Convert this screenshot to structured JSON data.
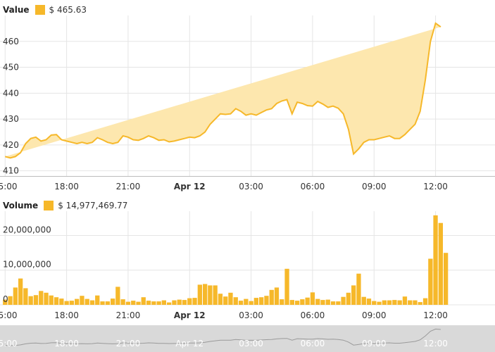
{
  "colors": {
    "series": "#f6b82a",
    "fill": "#fde7ae",
    "grid": "#e5e5e5",
    "axis": "#333333",
    "navigator_bg": "#d9d9d9",
    "navigator_line": "#9a9a9a"
  },
  "x_tick_labels": [
    "15:00",
    "18:00",
    "21:00",
    "Apr 12",
    "03:00",
    "06:00",
    "09:00",
    "12:00"
  ],
  "value_panel": {
    "label": "Value",
    "current": "$ 465.63"
  },
  "volume_panel": {
    "label": "Volume",
    "current": "$ 14,977,469.77"
  },
  "chart_data": [
    {
      "type": "area",
      "title": "Value",
      "x_unit": "hours since first tick",
      "ylim": [
        408,
        470
      ],
      "y_ticks": [
        410,
        420,
        430,
        440,
        450,
        460
      ],
      "grid": true,
      "x": [
        0,
        0.25,
        0.5,
        0.75,
        1,
        1.25,
        1.5,
        1.75,
        2,
        2.25,
        2.5,
        2.75,
        3,
        3.25,
        3.5,
        3.75,
        4,
        4.25,
        4.5,
        4.75,
        5,
        5.25,
        5.5,
        5.75,
        6,
        6.25,
        6.5,
        6.75,
        7,
        7.25,
        7.5,
        7.75,
        8,
        8.25,
        8.5,
        8.75,
        9,
        9.25,
        9.5,
        9.75,
        10,
        10.25,
        10.5,
        10.75,
        11,
        11.25,
        11.5,
        11.75,
        12,
        12.25,
        12.5,
        12.75,
        13,
        13.25,
        13.5,
        13.75,
        14,
        14.25,
        14.5,
        14.75,
        15,
        15.25,
        15.5,
        15.75,
        16,
        16.25,
        16.5,
        16.75,
        17,
        17.25,
        17.5,
        17.75,
        18,
        18.25,
        18.5,
        18.75,
        19,
        19.25,
        19.5,
        19.75,
        20,
        20.25,
        20.5,
        20.75,
        21,
        21.25,
        21.5,
        21.75,
        22,
        22.25,
        22.5,
        22.75,
        23,
        23.25,
        23.5,
        23.75
      ],
      "values": [
        415.5,
        415,
        415.5,
        417,
        420.5,
        422.5,
        423,
        421.5,
        422,
        423.8,
        424,
        422,
        421.5,
        421,
        420.5,
        421,
        420.5,
        421,
        422.8,
        422,
        421,
        420.5,
        421,
        423.5,
        423,
        422,
        421.8,
        422.5,
        423.5,
        422.8,
        421.8,
        422,
        421.2,
        421.5,
        422,
        422.5,
        423,
        422.8,
        423.5,
        425,
        428,
        430,
        432,
        431.8,
        432,
        434,
        433,
        431.5,
        432,
        431.5,
        432.5,
        433.5,
        434,
        436,
        437,
        437.5,
        432,
        436.5,
        436,
        435.2,
        435,
        436.8,
        435.8,
        434.5,
        435,
        434.2,
        432,
        426,
        416.5,
        418.5,
        421,
        422,
        422,
        422.5,
        423,
        423.5,
        422.5,
        422.5,
        424,
        426,
        428,
        433,
        445,
        460,
        467,
        465.6
      ]
    },
    {
      "type": "bar",
      "title": "Volume",
      "x_unit": "hours since first tick",
      "ylim": [
        0,
        27000000
      ],
      "y_ticks": [
        0,
        10000000,
        20000000
      ],
      "y_tick_labels": [
        "0",
        "10,000,000",
        "20,000,000"
      ],
      "grid": true,
      "x": [
        0,
        0.25,
        0.5,
        0.75,
        1,
        1.25,
        1.5,
        1.75,
        2,
        2.25,
        2.5,
        2.75,
        3,
        3.25,
        3.5,
        3.75,
        4,
        4.25,
        4.5,
        4.75,
        5,
        5.25,
        5.5,
        5.75,
        6,
        6.25,
        6.5,
        6.75,
        7,
        7.25,
        7.5,
        7.75,
        8,
        8.25,
        8.5,
        8.75,
        9,
        9.25,
        9.5,
        9.75,
        10,
        10.25,
        10.5,
        10.75,
        11,
        11.25,
        11.5,
        11.75,
        12,
        12.25,
        12.5,
        12.75,
        13,
        13.25,
        13.5,
        13.75,
        14,
        14.25,
        14.5,
        14.75,
        15,
        15.25,
        15.5,
        15.75,
        16,
        16.25,
        16.5,
        16.75,
        17,
        17.25,
        17.5,
        17.75,
        18,
        18.25,
        18.5,
        18.75,
        19,
        19.25,
        19.5,
        19.75,
        20,
        20.25,
        20.5,
        20.75,
        21,
        21.25,
        21.5,
        21.75,
        22,
        22.25,
        22.5,
        22.75,
        23,
        23.25,
        23.5,
        23.75
      ],
      "values": [
        1500000,
        2500000,
        5000000,
        7600000,
        4800000,
        2500000,
        2800000,
        4000000,
        3500000,
        2700000,
        2200000,
        1800000,
        1100000,
        1200000,
        1700000,
        2600000,
        1700000,
        1300000,
        2700000,
        1000000,
        1000000,
        1800000,
        5200000,
        1600000,
        900000,
        1200000,
        900000,
        2200000,
        1200000,
        1000000,
        1000000,
        1300000,
        700000,
        1300000,
        1500000,
        1400000,
        1900000,
        2000000,
        5800000,
        6000000,
        5600000,
        5600000,
        3200000,
        2400000,
        3500000,
        2200000,
        1200000,
        1700000,
        1100000,
        2000000,
        2200000,
        2600000,
        4300000,
        5000000,
        1600000,
        10400000,
        1400000,
        1200000,
        1600000,
        2100000,
        3600000,
        1700000,
        1400000,
        1500000,
        1000000,
        1000000,
        2300000,
        3500000,
        5600000,
        9000000,
        2300000,
        1800000,
        1100000,
        900000,
        1300000,
        1300000,
        1400000,
        1300000,
        2400000,
        1300000,
        1300000,
        800000,
        1900000,
        13300000,
        25800000,
        23600000,
        14977469.77
      ]
    }
  ]
}
